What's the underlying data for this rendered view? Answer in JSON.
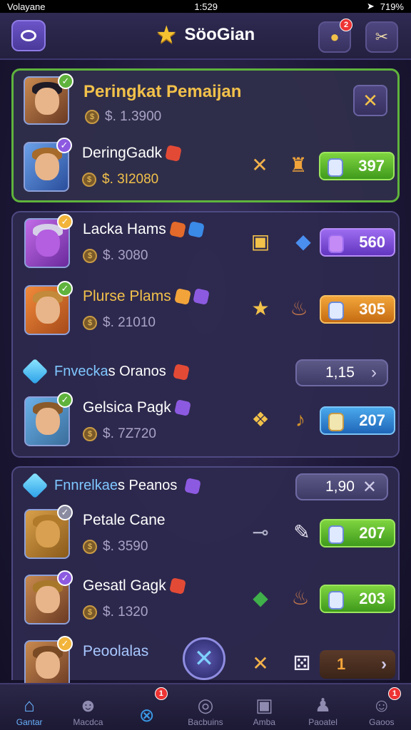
{
  "status_bar": {
    "carrier": "Volayane",
    "time": "1:529",
    "battery": "719%"
  },
  "header": {
    "title": "SöoGian",
    "notification_badge": "2"
  },
  "featured": {
    "title": "Peringkat Pemaijan",
    "close_label": "✕",
    "top_score": "$. 1.3900",
    "player": {
      "name": "DeringGadk",
      "score": "$. 3I2080",
      "value": "397"
    }
  },
  "group1": {
    "rows": [
      {
        "name": "Lacka Hams",
        "score": "$. 3080",
        "value": "560"
      },
      {
        "name": "Plurse Plams",
        "score": "$. 21010",
        "value": "305"
      }
    ],
    "section": {
      "title_a": "Fnvecka",
      "title_b": "s Oranos",
      "pill_value": "1,15",
      "pill_icon": "›"
    },
    "row3": {
      "name": "Gelsica Pagk",
      "score": "$. 7Z720",
      "value": "207"
    }
  },
  "group2": {
    "section": {
      "title_a": "Fnnrelkae",
      "title_b": "s Peanos",
      "pill_value": "1,90",
      "pill_icon": "✕"
    },
    "rows": [
      {
        "name": "Petale Cane",
        "score": "$. 3590",
        "value": "207"
      },
      {
        "name": "Gesatl Gagk",
        "score": "$. 1320",
        "value": "203"
      },
      {
        "name": "Peoolalas",
        "score": "",
        "value": "1"
      }
    ]
  },
  "bottom_nav": [
    {
      "label": "Gantar",
      "icon": "home-icon",
      "badge": ""
    },
    {
      "label": "Macdca",
      "icon": "mask-icon",
      "badge": ""
    },
    {
      "label": "",
      "icon": "close-circle-icon",
      "badge": "1"
    },
    {
      "label": "Bacbuins",
      "icon": "radar-icon",
      "badge": ""
    },
    {
      "label": "Amba",
      "icon": "camera-icon",
      "badge": ""
    },
    {
      "label": "Paoatel",
      "icon": "person-icon",
      "badge": ""
    },
    {
      "label": "Gaoos",
      "icon": "profile-icon",
      "badge": "1"
    }
  ],
  "colors": {
    "accent_gold": "#f2c14a",
    "green_pill": "#5fb33c",
    "purple_pill": "#7a4ad8",
    "orange_pill": "#e08a24",
    "blue_pill": "#2f82d4"
  }
}
